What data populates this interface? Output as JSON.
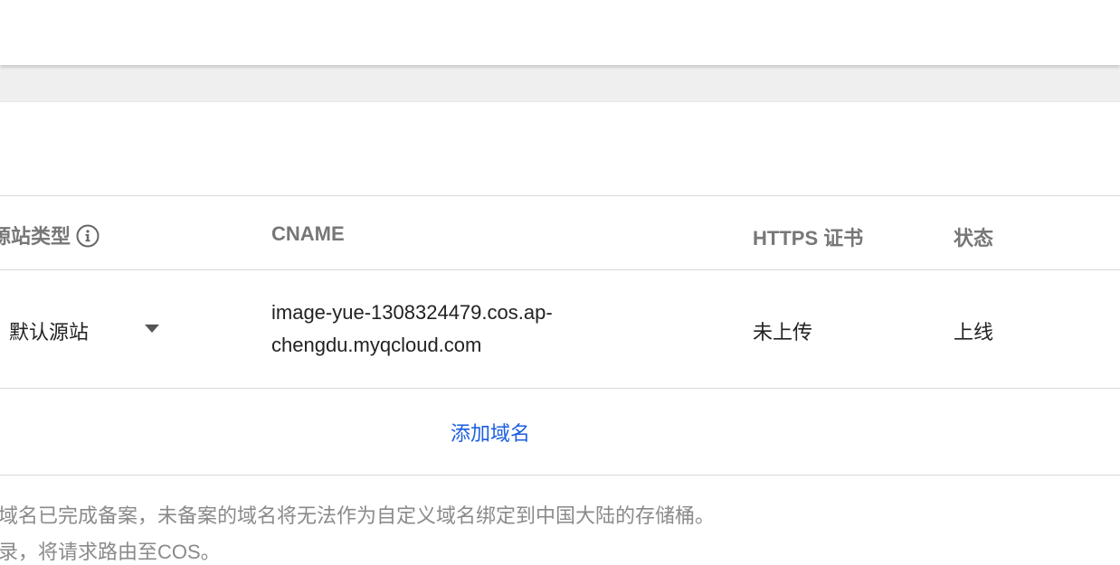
{
  "table": {
    "headers": {
      "origin_type": "源站类型",
      "cname": "CNAME",
      "https_cert": "HTTPS 证书",
      "status": "状态"
    },
    "rows": [
      {
        "origin_type": "默认源站",
        "cname_line1": "image-yue-1308324479.cos.ap-",
        "cname_line2": "chengdu.myqcloud.com",
        "https_cert": "未上传",
        "status": "上线"
      }
    ],
    "add_domain_label": "添加域名"
  },
  "notes": {
    "line1": "域名已完成备案，未备案的域名将无法作为自定义域名绑定到中国大陆的存储桶。",
    "line2": "录，将请求路由至COS。"
  },
  "colors": {
    "link": "#1a5fe0",
    "header_text": "#777777",
    "note_text": "#8a8a8a"
  },
  "icons": {
    "origin_type_info": "info-icon",
    "origin_dropdown": "caret-down-icon"
  }
}
